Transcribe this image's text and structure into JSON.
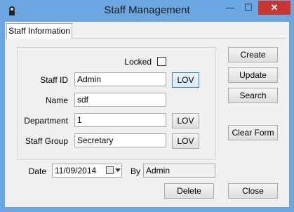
{
  "window": {
    "title": "Staff Management",
    "minimize_glyph": "—",
    "maximize_glyph": "☐",
    "close_glyph": "✕"
  },
  "tabs": [
    {
      "label": "Staff Information",
      "selected": true
    }
  ],
  "form": {
    "locked": {
      "label": "Locked",
      "checked": false
    },
    "staff_id": {
      "label": "Staff ID",
      "value": "Admin",
      "lov": "LOV"
    },
    "name": {
      "label": "Name",
      "value": "sdf"
    },
    "department": {
      "label": "Department",
      "value": "1",
      "lov": "LOV"
    },
    "staff_group": {
      "label": "Staff Group",
      "value": "Secretary",
      "lov": "LOV"
    },
    "date": {
      "label": "Date",
      "value": "11/09/2014"
    },
    "by": {
      "label": "By",
      "value": "Admin"
    }
  },
  "buttons": {
    "create": "Create",
    "update": "Update",
    "search": "Search",
    "clear_form": "Clear Form",
    "delete": "Delete",
    "close": "Close"
  },
  "colors": {
    "frame": "#6aa7e3",
    "close_button": "#c7372f",
    "client_bg": "#f0f0f0"
  }
}
